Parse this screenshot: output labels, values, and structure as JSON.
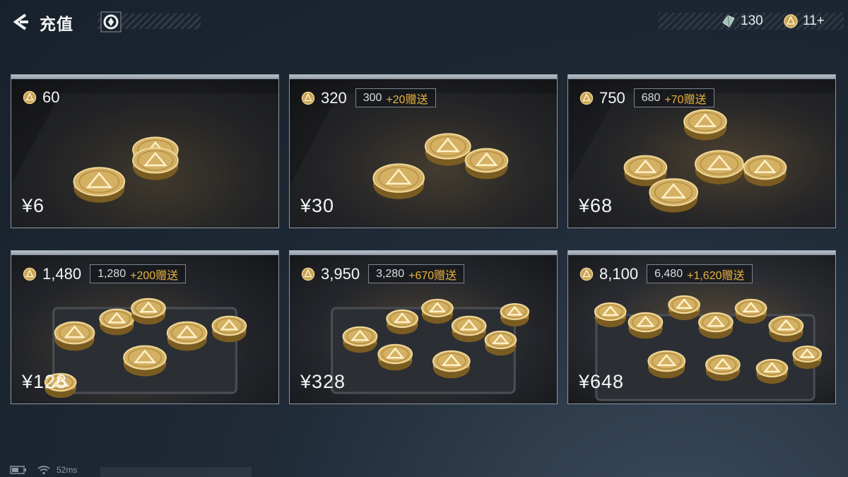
{
  "header": {
    "title": "充值"
  },
  "currencies": {
    "gem_count": "130",
    "coin_count": "11+"
  },
  "cards": [
    {
      "amount": "60",
      "bonus_base": "",
      "bonus_plus": "",
      "price": "¥6"
    },
    {
      "amount": "320",
      "bonus_base": "300",
      "bonus_plus": "+20赠送",
      "price": "¥30"
    },
    {
      "amount": "750",
      "bonus_base": "680",
      "bonus_plus": "+70赠送",
      "price": "¥68"
    },
    {
      "amount": "1,480",
      "bonus_base": "1,280",
      "bonus_plus": "+200赠送",
      "price": "¥128"
    },
    {
      "amount": "3,950",
      "bonus_base": "3,280",
      "bonus_plus": "+670赠送",
      "price": "¥328"
    },
    {
      "amount": "8,100",
      "bonus_base": "6,480",
      "bonus_plus": "+1,620赠送",
      "price": "¥648"
    }
  ],
  "status": {
    "latency": "52ms"
  },
  "icons": [
    "back-arrow-icon",
    "brand-logo-icon",
    "gem-icon",
    "coin-icon",
    "battery-icon",
    "wifi-icon"
  ],
  "colors": {
    "accent_gold": "#e8b23f",
    "background": "#1f2a36",
    "card_border": "#8d98a3"
  }
}
